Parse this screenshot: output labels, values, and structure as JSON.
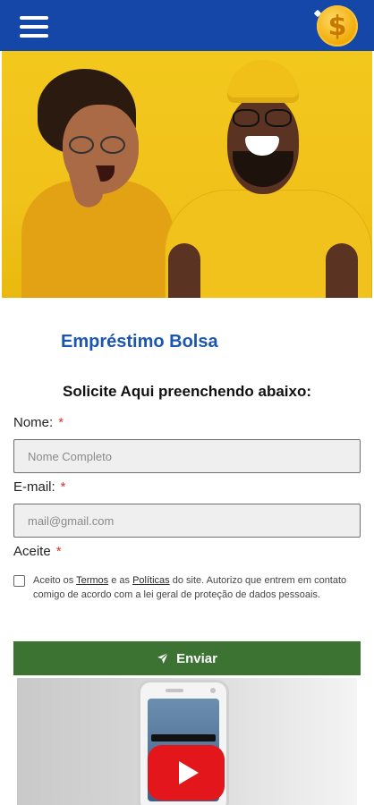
{
  "header": {
    "menu_icon": "hamburger-menu-icon",
    "logo_icon": "dollar-coin-icon",
    "brand_color": "#1447a8"
  },
  "hero": {
    "image": "two-people-laughing-yellow-background"
  },
  "page": {
    "title": "Empréstimo Bolsa",
    "subtitle": "Solicite Aqui preenchendo abaixo:"
  },
  "form": {
    "name_label": "Nome:",
    "name_placeholder": "Nome Completo",
    "name_value": "",
    "email_label": "E-mail:",
    "email_placeholder": "mail@gmail.com",
    "email_value": "",
    "accept_label": "Aceite",
    "required_mark": "*",
    "consent": {
      "checked": false,
      "prefix": "Aceito os ",
      "terms_link": "Termos",
      "middle": " e as ",
      "policies_link": "Políticas",
      "suffix": " do site. Autorizo que entrem em contato comigo de acordo com a lei geral de proteção de dados pessoais."
    },
    "submit_label": "Enviar",
    "submit_icon": "paper-plane-icon",
    "submit_color": "#3c7333"
  },
  "video": {
    "play_icon": "youtube-play-icon",
    "play_color": "#e3171b"
  }
}
